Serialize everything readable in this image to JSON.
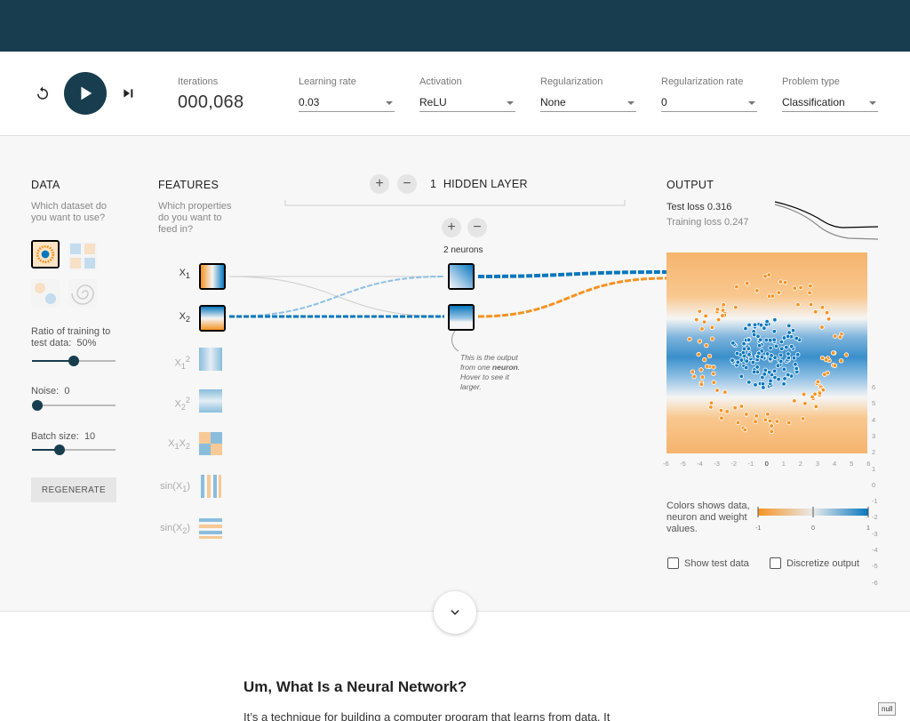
{
  "controls": {
    "iterations_label": "Iterations",
    "iterations_value": "000,068",
    "learning_rate": {
      "label": "Learning rate",
      "value": "0.03"
    },
    "activation": {
      "label": "Activation",
      "value": "ReLU"
    },
    "regularization": {
      "label": "Regularization",
      "value": "None"
    },
    "regularization_rate": {
      "label": "Regularization rate",
      "value": "0"
    },
    "problem_type": {
      "label": "Problem type",
      "value": "Classification"
    }
  },
  "data_panel": {
    "title": "DATA",
    "subtitle": "Which dataset do you want to use?",
    "datasets": [
      "circle",
      "xor",
      "gaussian",
      "spiral"
    ],
    "selected_dataset": "circle",
    "ratio_label": "Ratio of training to test data:",
    "ratio_value": "50%",
    "ratio_level": 0.5,
    "noise_label": "Noise:",
    "noise_value": "0",
    "noise_level": 0,
    "batch_label": "Batch size:",
    "batch_value": "10",
    "batch_level": 0.3,
    "regenerate_label": "REGENERATE"
  },
  "features_panel": {
    "title": "FEATURES",
    "subtitle": "Which properties do you want to feed in?",
    "features": [
      {
        "label": "X₁",
        "active": true
      },
      {
        "label": "X₂",
        "active": true
      },
      {
        "label": "X₁²",
        "active": false
      },
      {
        "label": "X₂²",
        "active": false
      },
      {
        "label": "X₁X₂",
        "active": false
      },
      {
        "label": "sin(X₁)",
        "active": false
      },
      {
        "label": "sin(X₂)",
        "active": false
      }
    ]
  },
  "network": {
    "layer_count": "1",
    "layer_label": "HIDDEN LAYER",
    "neurons_label": "2 neurons",
    "hint": {
      "before": "This is the output from one ",
      "strong": "neuron",
      "after": ". Hover to see it larger."
    }
  },
  "output_panel": {
    "title": "OUTPUT",
    "test_loss_label": "Test loss",
    "test_loss_value": "0.316",
    "training_loss_label": "Training loss",
    "training_loss_value": "0.247",
    "y_ticks": [
      "6",
      "5",
      "4",
      "3",
      "2",
      "1",
      "0",
      "-1",
      "-2",
      "-3",
      "-4",
      "-5",
      "-6"
    ],
    "x_ticks": [
      "-6",
      "-5",
      "-4",
      "-3",
      "-2",
      "-1",
      "0",
      "1",
      "2",
      "3",
      "4",
      "5",
      "6"
    ],
    "legend_text": "Colors shows data, neuron and weight values.",
    "legend_ticks": [
      "-1",
      "0",
      "1"
    ],
    "show_test_data_label": "Show test data",
    "discretize_label": "Discretize output",
    "colors": {
      "orange": "#f59322",
      "blue": "#0877bd",
      "navy": "#183d4e"
    }
  },
  "article": {
    "title": "Um, What Is a Neural Network?",
    "text": "It’s a technique for building a computer program that learns from data. It"
  },
  "badge": "null"
}
